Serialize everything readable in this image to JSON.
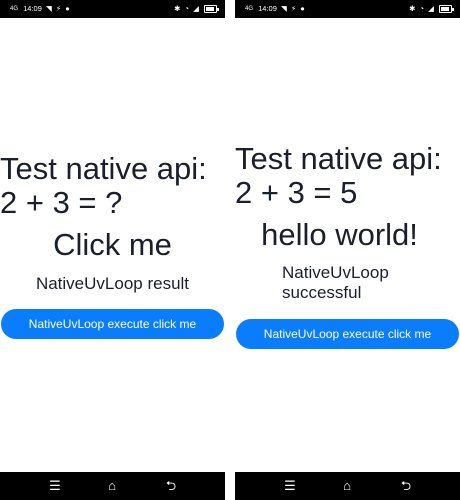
{
  "left_screen": {
    "status_bar": {
      "network": "4G",
      "time": "14:09",
      "left_icons": [
        "wifi-icon",
        "usb-icon",
        "notification-icon",
        "data-icon"
      ],
      "right_icons": [
        "bluetooth-icon",
        "alarm-icon",
        "signal-icon",
        "battery-icon"
      ]
    },
    "title": "Test native api:",
    "expression": "2 + 3 = ?",
    "action_text": "Click me",
    "result_label": "NativeUvLoop result",
    "button_label": "NativeUvLoop execute click me"
  },
  "right_screen": {
    "status_bar": {
      "network": "4G",
      "time": "14:09",
      "left_icons": [
        "wifi-icon",
        "usb-icon",
        "notification-icon",
        "data-icon"
      ],
      "right_icons": [
        "bluetooth-icon",
        "alarm-icon",
        "signal-icon",
        "battery-icon"
      ]
    },
    "title": "Test native api:",
    "expression": "2 + 3 = 5",
    "action_text": "hello world!",
    "result_label": "NativeUvLoop successful",
    "button_label": "NativeUvLoop execute click me"
  },
  "nav_bar": {
    "menu_icon": "menu-icon",
    "home_icon": "home-icon",
    "back_icon": "back-icon"
  },
  "colors": {
    "accent": "#0a7dfd",
    "text": "#1a1f2b",
    "bars": "#000000"
  }
}
